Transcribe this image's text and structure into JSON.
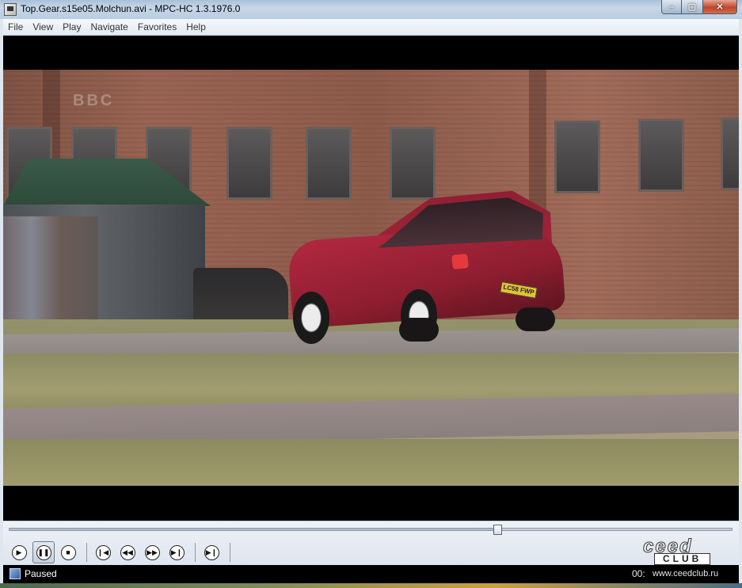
{
  "window": {
    "title": "Top.Gear.s15e05.Molchun.avi - MPC-HC 1.3.1976.0",
    "controls": {
      "minimize": "–",
      "maximize": "▢",
      "close": "✕"
    }
  },
  "menu": {
    "items": [
      {
        "label": "File"
      },
      {
        "label": "View"
      },
      {
        "label": "Play"
      },
      {
        "label": "Navigate"
      },
      {
        "label": "Favorites"
      },
      {
        "label": "Help"
      }
    ]
  },
  "video": {
    "sign_text": "BBC",
    "plate_text": "LC58 FWP"
  },
  "playback": {
    "seek_position_fraction": 0.675,
    "buttons": [
      {
        "name": "play-button",
        "icon": "play-icon"
      },
      {
        "name": "pause-button",
        "icon": "pause-icon",
        "active": true
      },
      {
        "name": "stop-button",
        "icon": "stop-icon"
      },
      {
        "name": "previous-button",
        "icon": "skip-back-icon"
      },
      {
        "name": "rewind-button",
        "icon": "rewind-icon"
      },
      {
        "name": "fast-forward-button",
        "icon": "fast-forward-icon"
      },
      {
        "name": "next-button",
        "icon": "skip-forward-icon"
      },
      {
        "name": "frame-step-button",
        "icon": "frame-step-icon"
      }
    ]
  },
  "watermark": {
    "brand": "ceed",
    "club": "CLUB",
    "url": "www.ceedclub.ru"
  },
  "status": {
    "state": "Paused",
    "time": "00:"
  },
  "colors": {
    "status_bg": "#000000",
    "video_bg": "#000000"
  }
}
